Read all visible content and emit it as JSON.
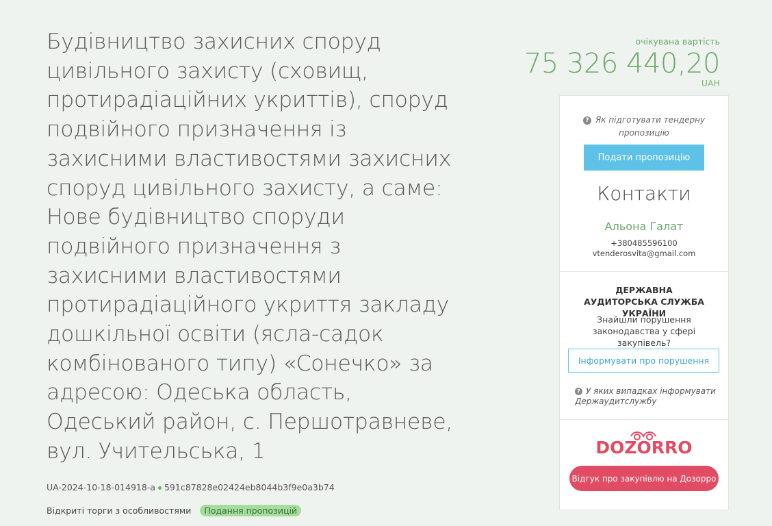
{
  "tender": {
    "title": "Будівництво захисних споруд цивільного захисту (сховищ, протирадіаційних укриттів), споруд подвійного призначення із захисними властивостями захисних споруд цивільного захисту, а саме: Нове будівництво споруди подвійного призначення з захисними властивостями протирадіаційного укриття закладу дошкільної освіти (ясла-садок комбінованого типу) «Сонечко» за адресою: Одеська область, Одеський район, с. Першотравневе, вул. Учительська, 1",
    "id": "UA-2024-10-18-014918-a",
    "hash": "591c87828e02424eb8044b3f9e0a3b74",
    "procedure_type": "Відкриті торги з особливостями",
    "status": "Подання пропозицій"
  },
  "price": {
    "label": "очікувана вартість",
    "amount": "75 326 440,20",
    "currency": "UAH"
  },
  "panel": {
    "help_link": "Як підготувати тендерну пропозицію",
    "submit_button": "Подати пропозицію",
    "contacts_heading": "Контакти",
    "contact_name": "Альона Галат",
    "contact_phone": "+380485596100",
    "contact_email": "vtenderosvita@gmail.com",
    "audit_heading": "ДЕРЖАВНА АУДИТОРСЬКА СЛУЖБА УКРАЇНИ",
    "audit_text": "Знайшли порушення законодавства у сфері закупівель?",
    "report_button": "Інформувати про порушення",
    "when_report_link": "У яких випадках інформувати Держаудитслужбу",
    "logo_text": "DOZORRO",
    "feedback_button": "Відгук про закупівлю на Дозорро"
  },
  "colors": {
    "accent_green": "#6ea86c",
    "button_blue": "#5ec2e8",
    "dozorro_red": "#e14c64",
    "status_badge": "#a5dd9b"
  }
}
